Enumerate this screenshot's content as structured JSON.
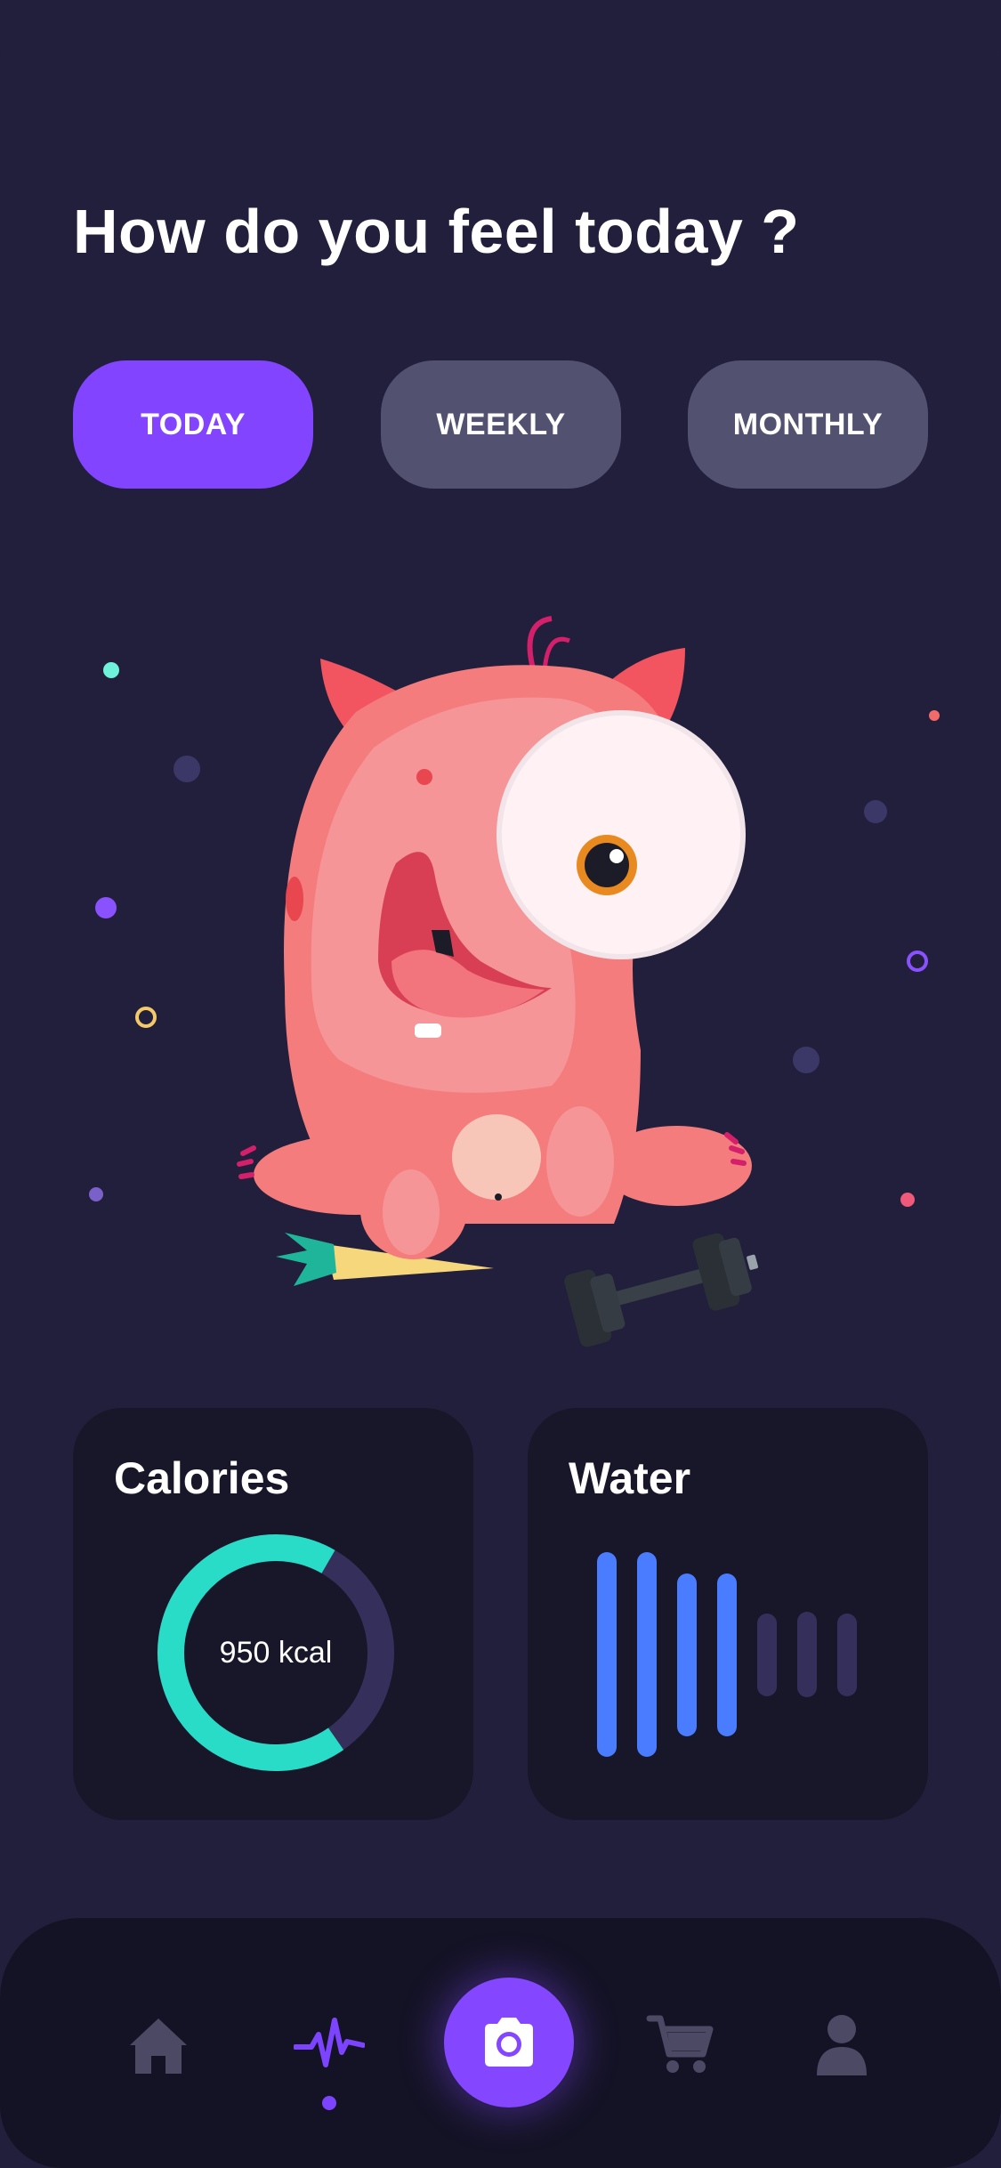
{
  "header": {
    "title": "How do you feel today ?"
  },
  "filters": {
    "items": [
      {
        "label": "TODAY",
        "active": true
      },
      {
        "label": "WEEKLY",
        "active": false
      },
      {
        "label": "MONTHLY",
        "active": false
      }
    ]
  },
  "illustration": {
    "name": "pink-monster-with-dumbbell"
  },
  "cards": {
    "calories": {
      "title": "Calories",
      "value_label": "950 kcal",
      "progress": 0.68
    },
    "water": {
      "title": "Water",
      "filled_bars": 4,
      "total_bars": 7
    }
  },
  "bottom_nav": {
    "items": [
      {
        "icon": "home-icon",
        "active": false
      },
      {
        "icon": "activity-icon",
        "active": true
      },
      {
        "icon": "camera-icon",
        "active": false
      },
      {
        "icon": "cart-icon",
        "active": false
      },
      {
        "icon": "profile-icon",
        "active": false
      }
    ]
  },
  "colors": {
    "background": "#221f3c",
    "accent": "#8244ff",
    "pill_inactive": "#525170",
    "card": "#181629",
    "calorie_ring": "#29dcc7",
    "ring_track": "#35305b",
    "water_bar": "#4a7cff",
    "water_bar_empty": "#35305b"
  }
}
